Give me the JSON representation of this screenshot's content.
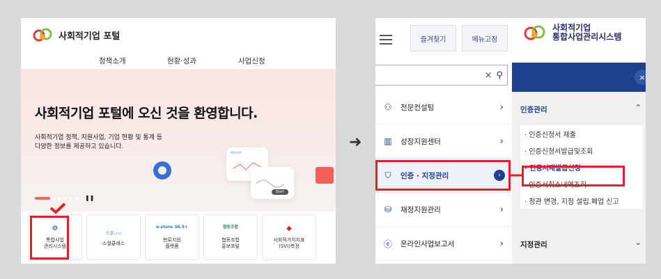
{
  "left": {
    "site_title": "사회적기업 포털",
    "nav": [
      "정책소개",
      "현황·성과",
      "사업신청"
    ],
    "hero": {
      "heading": "사회적기업 포털에 오신 것을 환영합니다.",
      "desc_line1": "사회적기업 정책, 지원사업, 기업 현황 및 통계 등",
      "desc_line2": "다양한 정보를 제공하고 있습니다.",
      "card_label": "Month",
      "btn_label": "Start"
    },
    "tiles": [
      {
        "icon": "gear-window-icon",
        "brand": "",
        "label_line1": "통합사업",
        "label_line2": "관리시스템"
      },
      {
        "icon": "social-class-logo",
        "brand": "소셜클래스",
        "label_line1": "소셜클래스",
        "label_line2": ""
      },
      {
        "icon": "e-store-logo",
        "brand": "e-store 36.5+",
        "label_line1": "판로지원",
        "label_line2": "플랫폼"
      },
      {
        "icon": "coop-logo",
        "brand": "협동조합",
        "label_line1": "협동조합",
        "label_line2": "홍보포털"
      },
      {
        "icon": "svi-logo",
        "brand": "",
        "label_line1": "사회적가치지표",
        "label_line2": "(SVI)측정"
      }
    ]
  },
  "right": {
    "top_buttons": [
      "즐겨찾기",
      "메뉴고정"
    ],
    "system_title_line1": "사회적기업",
    "system_title_line2": "통합사업관리시스템",
    "menu": [
      {
        "icon": "consult-icon",
        "label": "전문컨설팅"
      },
      {
        "icon": "building-chart-icon",
        "label": "성장지원센터"
      },
      {
        "icon": "shield-check-icon",
        "label": "인증 · 지정관리"
      },
      {
        "icon": "database-icon",
        "label": "재정지원관리"
      },
      {
        "icon": "e-circle-icon",
        "label": "온라인사업보고서"
      }
    ],
    "sidebar": {
      "section1": "인증관리",
      "items": [
        "· 인증신청서 제출",
        "· 인증신청서발급및조회",
        "· 인증서재발급신청",
        "· 인증서취소내역조회",
        "· 정관 변경, 지점 설립.폐업 신고"
      ],
      "section2": "지정관리"
    }
  },
  "colors": {
    "highlight_red": "#e3202a",
    "navy": "#1f3f8f",
    "hero_bg": "#fbe5e0"
  }
}
